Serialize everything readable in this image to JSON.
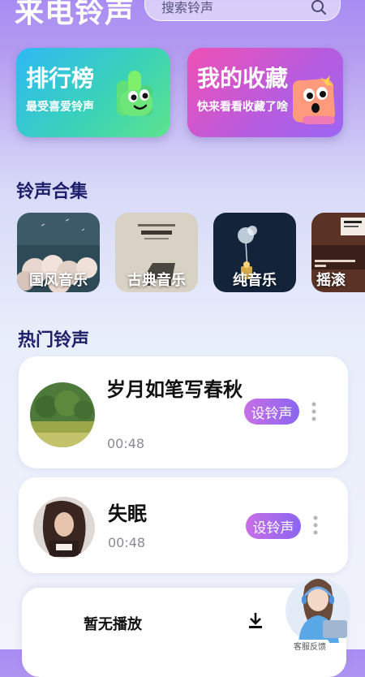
{
  "header": {
    "title": "来电铃声",
    "search_placeholder": "搜索铃声"
  },
  "cards": [
    {
      "title": "排行榜",
      "subtitle": "最受喜爱铃声"
    },
    {
      "title": "我的收藏",
      "subtitle": "快来看看收藏了啥"
    }
  ],
  "collections": {
    "title": "铃声合集",
    "items": [
      {
        "label": "国风音乐"
      },
      {
        "label": "古典音乐"
      },
      {
        "label": "纯音乐"
      },
      {
        "label": "摇滚"
      }
    ]
  },
  "hot": {
    "title": "热门铃声",
    "songs": [
      {
        "title": "岁月如笔写春秋",
        "duration": "00:48",
        "button": "设铃声"
      },
      {
        "title": "失眠",
        "duration": "00:48",
        "button": "设铃声"
      }
    ]
  },
  "player": {
    "status": "暂无播放"
  },
  "feedback": {
    "label": "客服反馈"
  },
  "colors": {
    "title_text": "#1d1f6b",
    "button_start": "#c86fe6",
    "button_end": "#8a66f0"
  }
}
